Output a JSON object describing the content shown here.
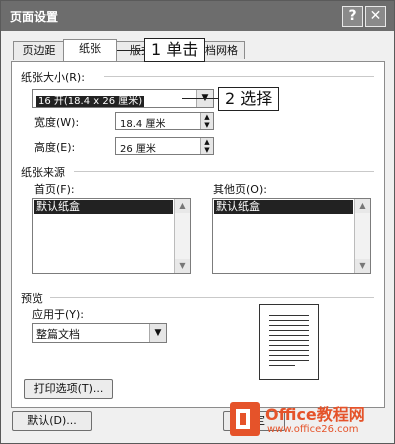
{
  "window": {
    "title": "页面设置",
    "help_label": "?",
    "close_label": "✕"
  },
  "tabs": [
    {
      "label": "页边距"
    },
    {
      "label": "纸张"
    },
    {
      "label": "版式"
    },
    {
      "label": "文档网格"
    }
  ],
  "paper_size": {
    "group_label": "纸张大小(R):",
    "selected": "16 开(18.4 x 26 厘米)",
    "width_label": "宽度(W):",
    "width_value": "18.4 厘米",
    "height_label": "高度(E):",
    "height_value": "26 厘米"
  },
  "paper_source": {
    "group_label": "纸张来源",
    "first_page_label": "首页(F):",
    "first_page_item": "默认纸盒",
    "other_pages_label": "其他页(O):",
    "other_pages_item": "默认纸盒"
  },
  "preview": {
    "group_label": "预览",
    "apply_to_label": "应用于(Y):",
    "apply_to_value": "整篇文档"
  },
  "buttons": {
    "print_options": "打印选项(T)...",
    "default": "默认(D)...",
    "ok": "确定"
  },
  "annotations": {
    "step1": "1 单击",
    "step2": "2 选择"
  },
  "watermark": {
    "brand": "Office教程网",
    "url": "www.office26.com"
  }
}
